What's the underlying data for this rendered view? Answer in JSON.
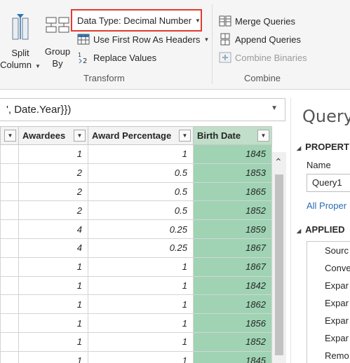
{
  "ribbon": {
    "split_column": {
      "line1": "Split",
      "line2": "Column"
    },
    "group_by": {
      "line1": "Group",
      "line2": "By"
    },
    "data_type": "Data Type: Decimal Number",
    "first_row_headers": "Use First Row As Headers",
    "replace_values": "Replace Values",
    "transform_label": "Transform",
    "merge_queries": "Merge Queries",
    "append_queries": "Append Queries",
    "combine_binaries": "Combine Binaries",
    "combine_label": "Combine"
  },
  "formula": {
    "text": "', Date.Year}})"
  },
  "grid": {
    "columns": [
      "Awardees",
      "Award Percentage",
      "Birth Date"
    ],
    "rows": [
      [
        "1",
        "1",
        "1845"
      ],
      [
        "2",
        "0.5",
        "1853"
      ],
      [
        "2",
        "0.5",
        "1865"
      ],
      [
        "2",
        "0.5",
        "1852"
      ],
      [
        "4",
        "0.25",
        "1859"
      ],
      [
        "4",
        "0.25",
        "1867"
      ],
      [
        "1",
        "1",
        "1867"
      ],
      [
        "1",
        "1",
        "1842"
      ],
      [
        "1",
        "1",
        "1862"
      ],
      [
        "1",
        "1",
        "1856"
      ],
      [
        "1",
        "1",
        "1852"
      ],
      [
        "1",
        "1",
        "1845"
      ]
    ]
  },
  "pane": {
    "title": "Query",
    "properties": "PROPERT",
    "name_label": "Name",
    "name_value": "Query1",
    "all_properties": "All Proper",
    "applied": "APPLIED",
    "steps": [
      "Sourc",
      "Conve",
      "Expar",
      "Expar",
      "Expar",
      "Expar",
      "Remo"
    ]
  }
}
